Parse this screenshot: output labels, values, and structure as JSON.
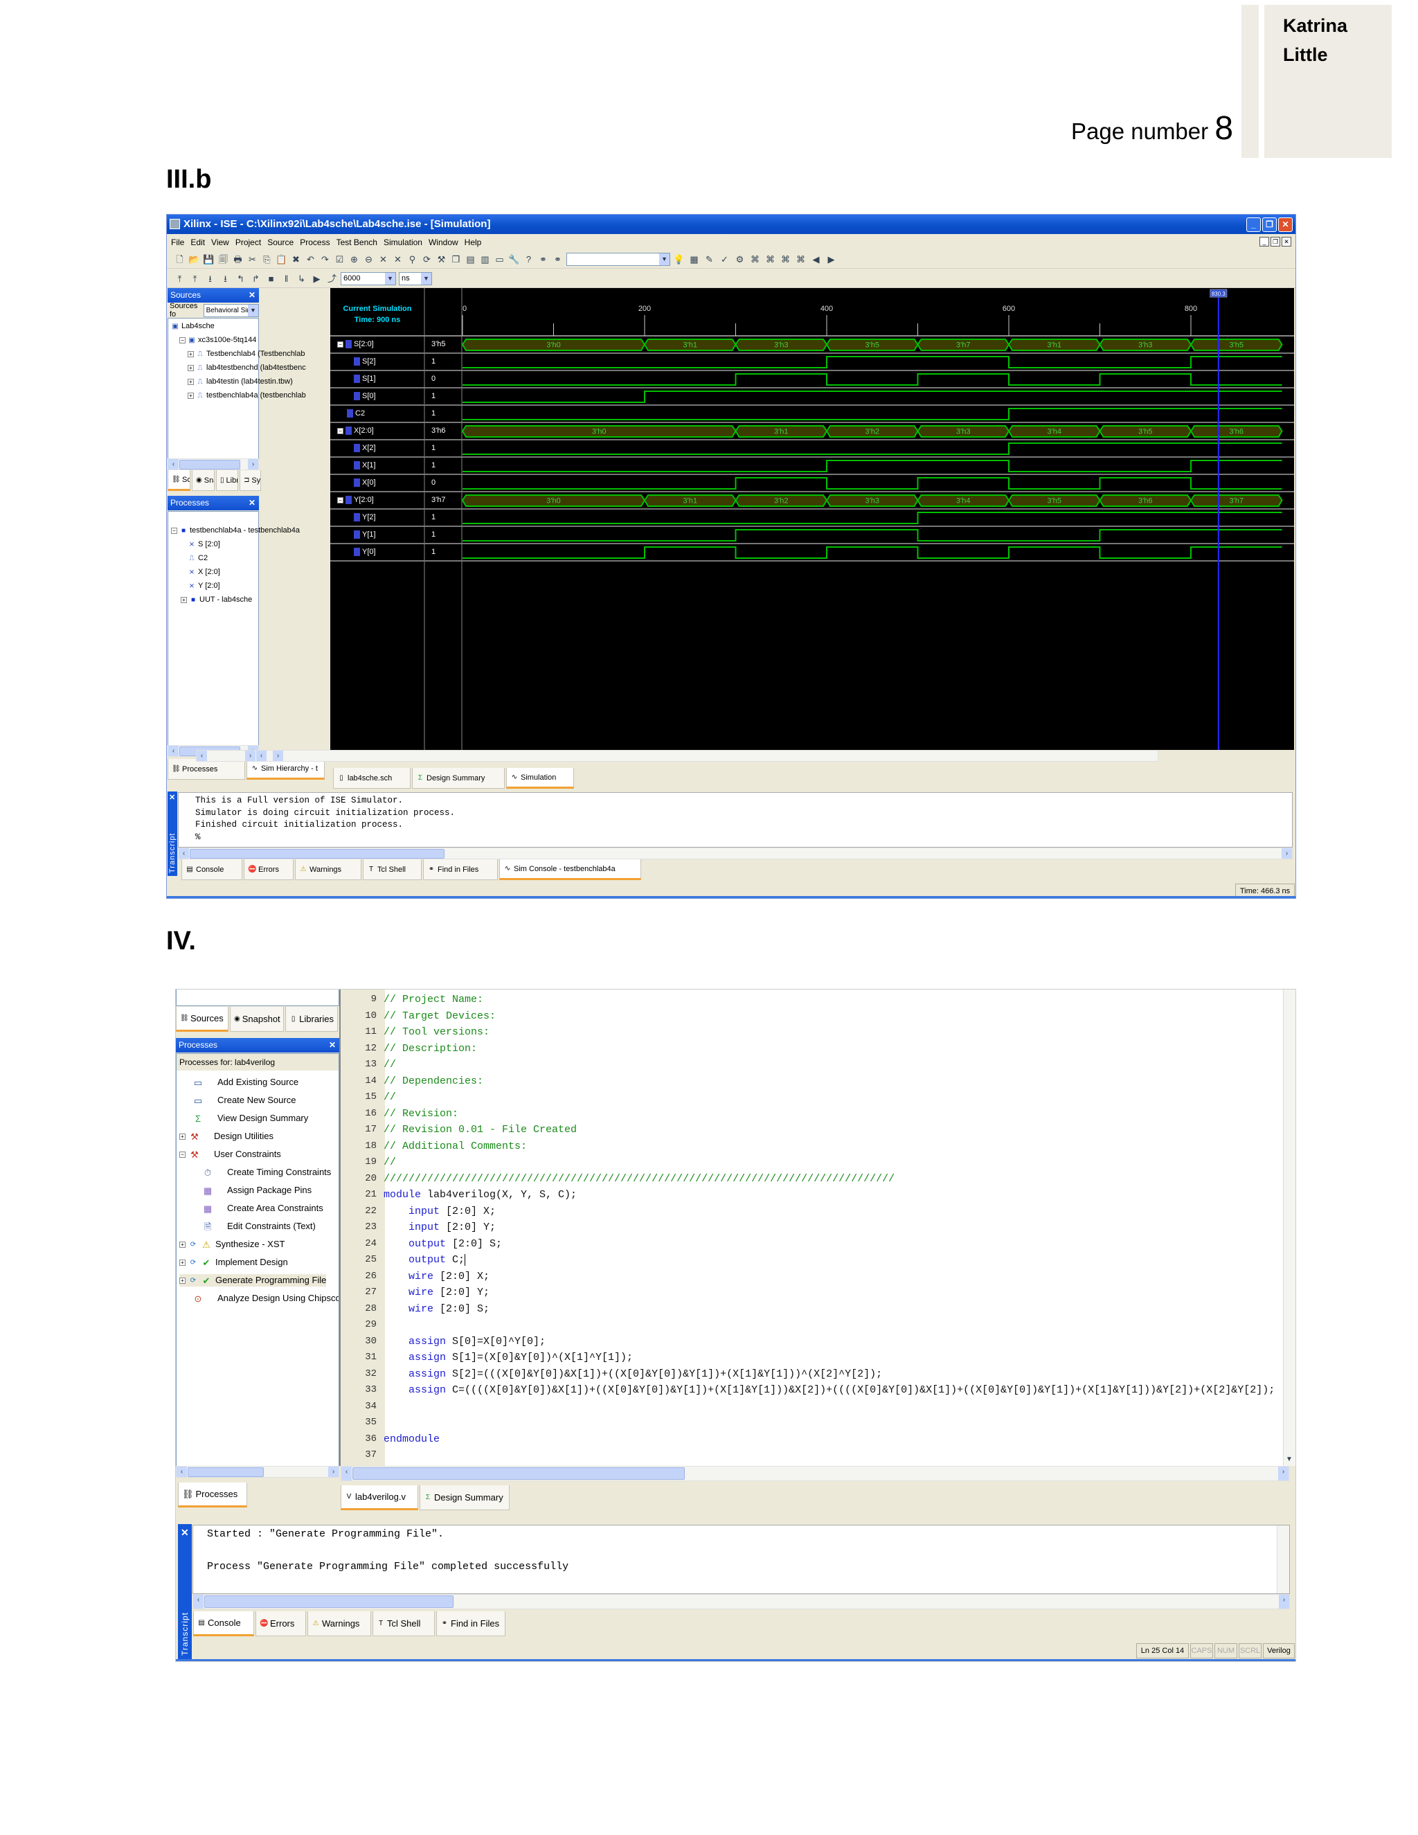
{
  "header": {
    "author_first": "Katrina",
    "author_last": "Little",
    "page_label": "Page number",
    "page_number": "8"
  },
  "section1": {
    "heading": "III.b",
    "window_title": "Xilinx - ISE - C:\\Xilinx92i\\Lab4sche\\Lab4sche.ise - [Simulation]",
    "menu": [
      "File",
      "Edit",
      "View",
      "Project",
      "Source",
      "Process",
      "Test Bench",
      "Simulation",
      "Window",
      "Help"
    ],
    "toolbar1_icons": [
      "new-file",
      "open-folder",
      "save",
      "save-all",
      "print",
      "cut",
      "copy",
      "paste",
      "delete",
      "undo",
      "redo",
      "check-doc",
      "zoom-in",
      "zoom-out",
      "zoom-fit",
      "zoom-full",
      "find-zoom",
      "refresh",
      "hammer",
      "cascade",
      "tile-horizontal",
      "tile-vertical",
      "window",
      "wrench",
      "help-pointer",
      "binoculars",
      "find-in-files"
    ],
    "toolbar1_icons_b": [
      "lightbulb",
      "new-report",
      "edit-report",
      "check-report",
      "chip",
      "route-1",
      "route-2",
      "route-3",
      "route-4",
      "back",
      "forward"
    ],
    "toolbar2_icons": [
      "step-back",
      "step-back-2",
      "run",
      "run-to",
      "restart",
      "restart-all",
      "stop",
      "pause",
      "step",
      "play",
      "run-for"
    ],
    "run_time": "6000",
    "run_unit": "ns",
    "sources": {
      "title": "Sources",
      "for_label": "Sources fo",
      "view": "Behavioral Simulation",
      "items": [
        {
          "label": "Lab4sche",
          "level": 0
        },
        {
          "label": "xc3s100e-5tq144",
          "level": 1
        },
        {
          "label": "Testbenchlab4 (Testbenchlab",
          "level": 2
        },
        {
          "label": "lab4testbenchd (lab4testbenc",
          "level": 2
        },
        {
          "label": "lab4testin (lab4testin.tbw)",
          "level": 2
        },
        {
          "label": "testbenchlab4a (testbenchlab",
          "level": 2
        }
      ],
      "tabs": [
        "Sourc",
        "Snaps",
        "Libra",
        "Syml"
      ]
    },
    "processes": {
      "title": "Processes",
      "root": "testbenchlab4a - testbenchlab4a",
      "items": [
        "S [2:0]",
        "C2",
        "X [2:0]",
        "Y [2:0]"
      ],
      "uut": "UUT - lab4sche",
      "tabs": [
        "Processes",
        "Sim Hierarchy - t"
      ]
    },
    "sim_time_label_1": "Current Simulation",
    "sim_time_label_2": "Time: 900 ns",
    "cursor_time": "830.3",
    "cursor_value": 830.3,
    "ruler": {
      "labels": [
        "0",
        "200",
        "400",
        "600",
        "800"
      ],
      "label_times": [
        0,
        200,
        400,
        600,
        800
      ],
      "minor_times": [
        100,
        300,
        500,
        700
      ],
      "max_time": 900
    },
    "signals": [
      {
        "name": "S[2:0]",
        "value": "3'h5",
        "type": "bus",
        "bus": "S"
      },
      {
        "name": "S[2]",
        "value": "1",
        "type": "bit",
        "bus": "S",
        "bit": 2
      },
      {
        "name": "S[1]",
        "value": "0",
        "type": "bit",
        "bus": "S",
        "bit": 1
      },
      {
        "name": "S[0]",
        "value": "1",
        "type": "bit",
        "bus": "S",
        "bit": 0
      },
      {
        "name": "C2",
        "value": "1",
        "type": "wire",
        "bus": "C2"
      },
      {
        "name": "X[2:0]",
        "value": "3'h6",
        "type": "bus",
        "bus": "X"
      },
      {
        "name": "X[2]",
        "value": "1",
        "type": "bit",
        "bus": "X",
        "bit": 2
      },
      {
        "name": "X[1]",
        "value": "1",
        "type": "bit",
        "bus": "X",
        "bit": 1
      },
      {
        "name": "X[0]",
        "value": "0",
        "type": "bit",
        "bus": "X",
        "bit": 0
      },
      {
        "name": "Y[2:0]",
        "value": "3'h7",
        "type": "bus",
        "bus": "Y"
      },
      {
        "name": "Y[2]",
        "value": "1",
        "type": "bit",
        "bus": "Y",
        "bit": 2
      },
      {
        "name": "Y[1]",
        "value": "1",
        "type": "bit",
        "bus": "Y",
        "bit": 1
      },
      {
        "name": "Y[0]",
        "value": "1",
        "type": "bit",
        "bus": "Y",
        "bit": 0
      }
    ],
    "waveforms": {
      "S": [
        {
          "t": 0,
          "v": 0
        },
        {
          "t": 200,
          "v": 1
        },
        {
          "t": 300,
          "v": 3
        },
        {
          "t": 400,
          "v": 5
        },
        {
          "t": 500,
          "v": 7
        },
        {
          "t": 600,
          "v": 1
        },
        {
          "t": 700,
          "v": 3
        },
        {
          "t": 800,
          "v": 5
        }
      ],
      "X": [
        {
          "t": 0,
          "v": 0
        },
        {
          "t": 300,
          "v": 1
        },
        {
          "t": 400,
          "v": 2
        },
        {
          "t": 500,
          "v": 3
        },
        {
          "t": 600,
          "v": 4
        },
        {
          "t": 700,
          "v": 5
        },
        {
          "t": 800,
          "v": 6
        }
      ],
      "Y": [
        {
          "t": 0,
          "v": 0
        },
        {
          "t": 200,
          "v": 1
        },
        {
          "t": 300,
          "v": 2
        },
        {
          "t": 400,
          "v": 3
        },
        {
          "t": 500,
          "v": 4
        },
        {
          "t": 600,
          "v": 5
        },
        {
          "t": 700,
          "v": 6
        },
        {
          "t": 800,
          "v": 7
        }
      ],
      "C2": [
        {
          "t": 0,
          "v": 0
        },
        {
          "t": 600,
          "v": 1
        }
      ]
    },
    "doc_tabs": [
      "lab4sche.sch",
      "Design Summary",
      "Simulation"
    ],
    "transcript_label": "Transcript",
    "transcript_lines": [
      "This is a Full version of ISE Simulator.",
      "Simulator is doing circuit initialization process.",
      "Finished circuit initialization process.",
      "%"
    ],
    "console_tabs": [
      "Console",
      "Errors",
      "Warnings",
      "Tcl Shell",
      "Find in Files",
      "Sim Console - testbenchlab4a"
    ],
    "status_time": "Time: 466.3 ns",
    "colors": {
      "wave": "#00c000",
      "bus_fill": "#3c3c00",
      "cursor": "#2828ff",
      "title": "#0a4fc8"
    }
  },
  "section2": {
    "heading": "IV.",
    "source_tabs": [
      "Sources",
      "Snapshot",
      "Libraries"
    ],
    "processes_title": "Processes",
    "processes_for": "Processes for: lab4verilog",
    "processes": [
      {
        "label": "Add Existing Source",
        "icon": "window"
      },
      {
        "label": "Create New Source",
        "icon": "window"
      },
      {
        "label": "View Design Summary",
        "icon": "sigma"
      },
      {
        "label": "Design Utilities",
        "icon": "tools"
      },
      {
        "label": "User Constraints",
        "icon": "tools"
      },
      {
        "label": "Create Timing Constraints",
        "icon": "timing"
      },
      {
        "label": "Assign Package Pins",
        "icon": "grid"
      },
      {
        "label": "Create Area Constraints",
        "icon": "grid"
      },
      {
        "label": "Edit Constraints (Text)",
        "icon": "document"
      },
      {
        "label": "Synthesize - XST",
        "icon": "warning"
      },
      {
        "label": "Implement Design",
        "icon": "check"
      },
      {
        "label": "Generate Programming File",
        "icon": "check"
      },
      {
        "label": "Analyze Design Using Chipscope",
        "icon": "chipscope"
      }
    ],
    "left_tab": "Processes",
    "code": [
      {
        "n": "9",
        "kw": "",
        "tx": "",
        "cm": "// Project Name:"
      },
      {
        "n": "10",
        "kw": "",
        "tx": "",
        "cm": "// Target Devices:"
      },
      {
        "n": "11",
        "kw": "",
        "tx": "",
        "cm": "// Tool versions:"
      },
      {
        "n": "12",
        "kw": "",
        "tx": "",
        "cm": "// Description:"
      },
      {
        "n": "13",
        "kw": "",
        "tx": "",
        "cm": "//"
      },
      {
        "n": "14",
        "kw": "",
        "tx": "",
        "cm": "// Dependencies:"
      },
      {
        "n": "15",
        "kw": "",
        "tx": "",
        "cm": "//"
      },
      {
        "n": "16",
        "kw": "",
        "tx": "",
        "cm": "// Revision:"
      },
      {
        "n": "17",
        "kw": "",
        "tx": "",
        "cm": "// Revision 0.01 - File Created"
      },
      {
        "n": "18",
        "kw": "",
        "tx": "",
        "cm": "// Additional Comments:"
      },
      {
        "n": "19",
        "kw": "",
        "tx": "",
        "cm": "//"
      },
      {
        "n": "20",
        "kw": "",
        "tx": "",
        "cm": "//////////////////////////////////////////////////////////////////////////////////"
      },
      {
        "n": "21",
        "kw": "module",
        "tx": " lab4verilog(X, Y, S, C);",
        "cm": ""
      },
      {
        "n": "22",
        "kw": "    input",
        "tx": " [2:0] X;",
        "cm": ""
      },
      {
        "n": "23",
        "kw": "    input",
        "tx": " [2:0] Y;",
        "cm": ""
      },
      {
        "n": "24",
        "kw": "    output",
        "tx": " [2:0] S;",
        "cm": ""
      },
      {
        "n": "25",
        "kw": "    output",
        "tx": " C;",
        "cm": "",
        "cursor": true
      },
      {
        "n": "26",
        "kw": "    wire",
        "tx": " [2:0] X;",
        "cm": ""
      },
      {
        "n": "27",
        "kw": "    wire",
        "tx": " [2:0] Y;",
        "cm": ""
      },
      {
        "n": "28",
        "kw": "    wire",
        "tx": " [2:0] S;",
        "cm": ""
      },
      {
        "n": "29",
        "kw": "",
        "tx": "",
        "cm": ""
      },
      {
        "n": "30",
        "kw": "    assign",
        "tx": " S[0]=X[0]^Y[0];",
        "cm": ""
      },
      {
        "n": "31",
        "kw": "    assign",
        "tx": " S[1]=(X[0]&Y[0])^(X[1]^Y[1]);",
        "cm": ""
      },
      {
        "n": "32",
        "kw": "    assign",
        "tx": " S[2]=(((X[0]&Y[0])&X[1])+((X[0]&Y[0])&Y[1])+(X[1]&Y[1]))^(X[2]^Y[2]);",
        "cm": ""
      },
      {
        "n": "33",
        "kw": "    assign",
        "tx": " C=((((X[0]&Y[0])&X[1])+((X[0]&Y[0])&Y[1])+(X[1]&Y[1]))&X[2])+((((X[0]&Y[0])&X[1])+((X[0]&Y[0])&Y[1])+(X[1]&Y[1]))&Y[2])+(X[2]&Y[2]);",
        "cm": ""
      },
      {
        "n": "34",
        "kw": "",
        "tx": "",
        "cm": ""
      },
      {
        "n": "35",
        "kw": "",
        "tx": "",
        "cm": ""
      },
      {
        "n": "36",
        "kw": "endmodule",
        "tx": "",
        "cm": ""
      },
      {
        "n": "37",
        "kw": "",
        "tx": "",
        "cm": ""
      }
    ],
    "doc_tabs": [
      "lab4verilog.v",
      "Design Summary"
    ],
    "transcript_label": "Transcript",
    "transcript_lines": [
      "Started : \"Generate Programming File\".",
      "",
      "Process \"Generate Programming File\" completed successfully"
    ],
    "console_tabs": [
      "Console",
      "Errors",
      "Warnings",
      "Tcl Shell",
      "Find in Files"
    ],
    "status": {
      "position": "Ln 25 Col 14",
      "caps": "CAPS",
      "num": "NUM",
      "scrl": "SCRL",
      "language": "Verilog"
    }
  }
}
